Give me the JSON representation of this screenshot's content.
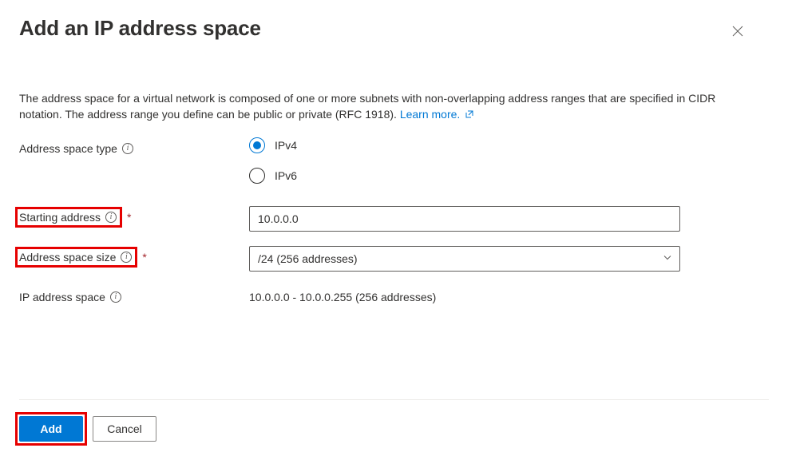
{
  "header": {
    "title": "Add an IP address space"
  },
  "description": {
    "text": "The address space for a virtual network is composed of one or more subnets with non-overlapping address ranges that are specified in CIDR notation. The address range you define can be public or private (RFC 1918). ",
    "learn_more": "Learn more."
  },
  "fields": {
    "address_space_type": {
      "label": "Address space type",
      "options": {
        "ipv4": "IPv4",
        "ipv6": "IPv6"
      }
    },
    "starting_address": {
      "label": "Starting address",
      "value": "10.0.0.0"
    },
    "address_space_size": {
      "label": "Address space size",
      "value": "/24 (256 addresses)"
    },
    "ip_address_space": {
      "label": "IP address space",
      "value": "10.0.0.0 - 10.0.0.255 (256 addresses)"
    }
  },
  "footer": {
    "add": "Add",
    "cancel": "Cancel"
  }
}
